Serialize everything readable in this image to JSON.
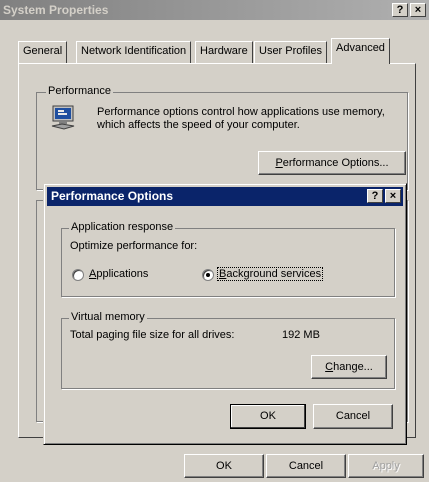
{
  "window": {
    "title": "System Properties",
    "help_glyph": "?",
    "close_glyph": "×"
  },
  "tabs": [
    {
      "label": "General"
    },
    {
      "label": "Network Identification"
    },
    {
      "label": "Hardware"
    },
    {
      "label": "User Profiles"
    },
    {
      "label": "Advanced"
    }
  ],
  "performance_group": {
    "label": "Performance",
    "description_line1": "Performance options control how applications use memory,",
    "description_line2": "which affects the speed of your computer.",
    "button_accel": "P",
    "button_rest": "erformance Options..."
  },
  "dialog": {
    "title": "Performance Options",
    "help_glyph": "?",
    "close_glyph": "×",
    "app_response": {
      "label": "Application response",
      "prompt": "Optimize performance for:",
      "options": [
        {
          "accel": "A",
          "rest": "pplications",
          "selected": false
        },
        {
          "accel": "B",
          "rest": "ackground services",
          "selected": true
        }
      ]
    },
    "virtual_memory": {
      "label": "Virtual memory",
      "paging_label": "Total paging file size for all drives:",
      "paging_value": "192 MB",
      "change_accel": "C",
      "change_rest": "hange..."
    },
    "ok_label": "OK",
    "cancel_label": "Cancel"
  },
  "footer": {
    "ok_label": "OK",
    "cancel_label": "Cancel",
    "apply_label": "Apply"
  }
}
